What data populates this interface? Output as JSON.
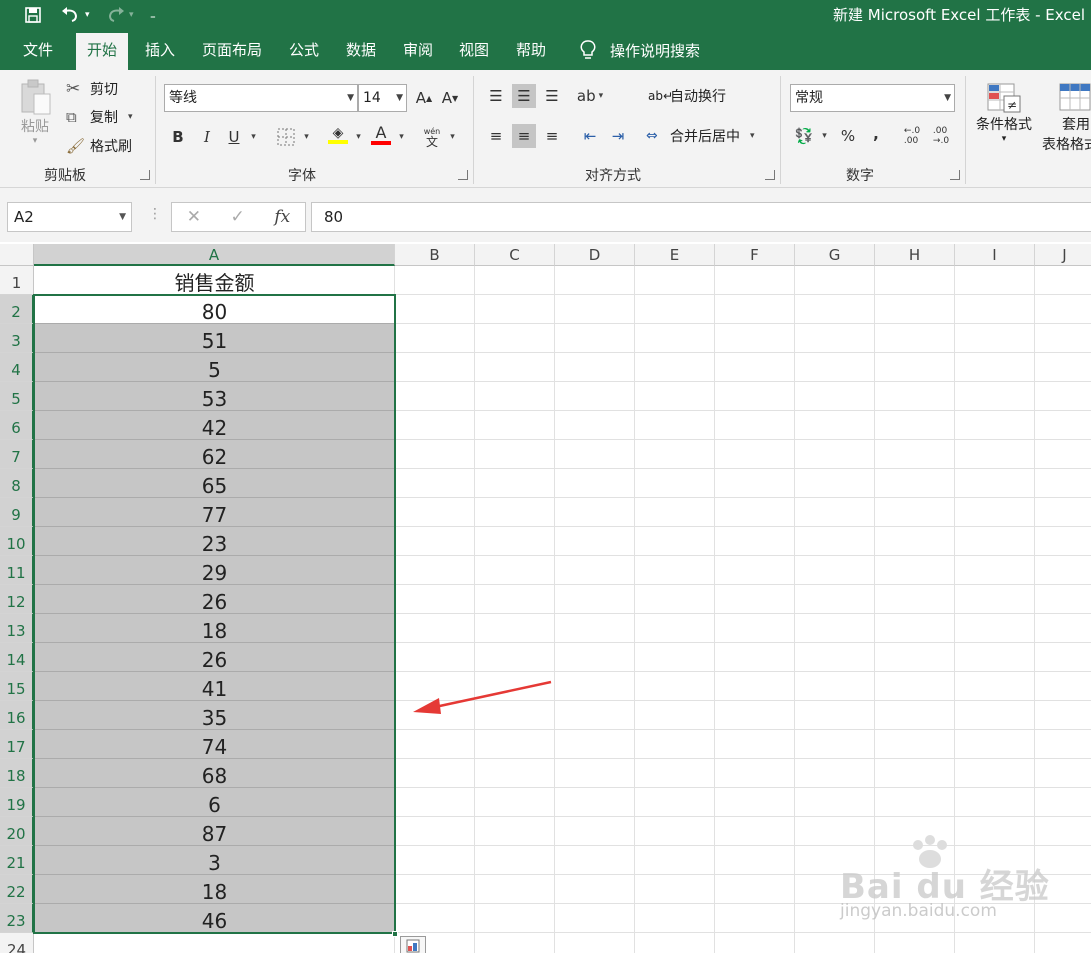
{
  "window": {
    "title": "新建 Microsoft Excel 工作表 - Excel"
  },
  "tabs": [
    "文件",
    "开始",
    "插入",
    "页面布局",
    "公式",
    "数据",
    "审阅",
    "视图",
    "帮助"
  ],
  "active_tab": "开始",
  "tell_me": "操作说明搜索",
  "ribbon": {
    "clipboard": {
      "paste": "粘贴",
      "cut": "剪切",
      "copy": "复制",
      "format_painter": "格式刷",
      "label": "剪贴板"
    },
    "font": {
      "name": "等线",
      "size": "14",
      "bold": "B",
      "italic": "I",
      "underline": "U",
      "label": "字体"
    },
    "alignment": {
      "wrap_text": "自动换行",
      "merge_center": "合并后居中",
      "label": "对齐方式"
    },
    "number": {
      "format": "常规",
      "percent": "%",
      "comma": ",",
      "label": "数字"
    },
    "styles": {
      "conditional": "条件格式",
      "table_1": "套用",
      "table_2": "表格格式"
    }
  },
  "formula_bar": {
    "name_box": "A2",
    "value": "80",
    "fx": "fx"
  },
  "columns": [
    "A",
    "B",
    "C",
    "D",
    "E",
    "F",
    "G",
    "H",
    "I",
    "J"
  ],
  "rows": [
    "1",
    "2",
    "3",
    "4",
    "5",
    "6",
    "7",
    "8",
    "9",
    "10",
    "11",
    "12",
    "13",
    "14",
    "15",
    "16",
    "17",
    "18",
    "19",
    "20",
    "21",
    "22",
    "23",
    "24"
  ],
  "cells": {
    "A1": "销售金额",
    "values": [
      "80",
      "51",
      "5",
      "53",
      "42",
      "62",
      "65",
      "77",
      "23",
      "29",
      "26",
      "18",
      "26",
      "41",
      "35",
      "74",
      "68",
      "6",
      "87",
      "3",
      "18",
      "46"
    ]
  },
  "watermark": {
    "brand": "Bai du 经验",
    "url": "jingyan.baidu.com"
  },
  "colors": {
    "brand": "#217346",
    "selection": "#c6c6c6",
    "arrow": "#e53935"
  }
}
